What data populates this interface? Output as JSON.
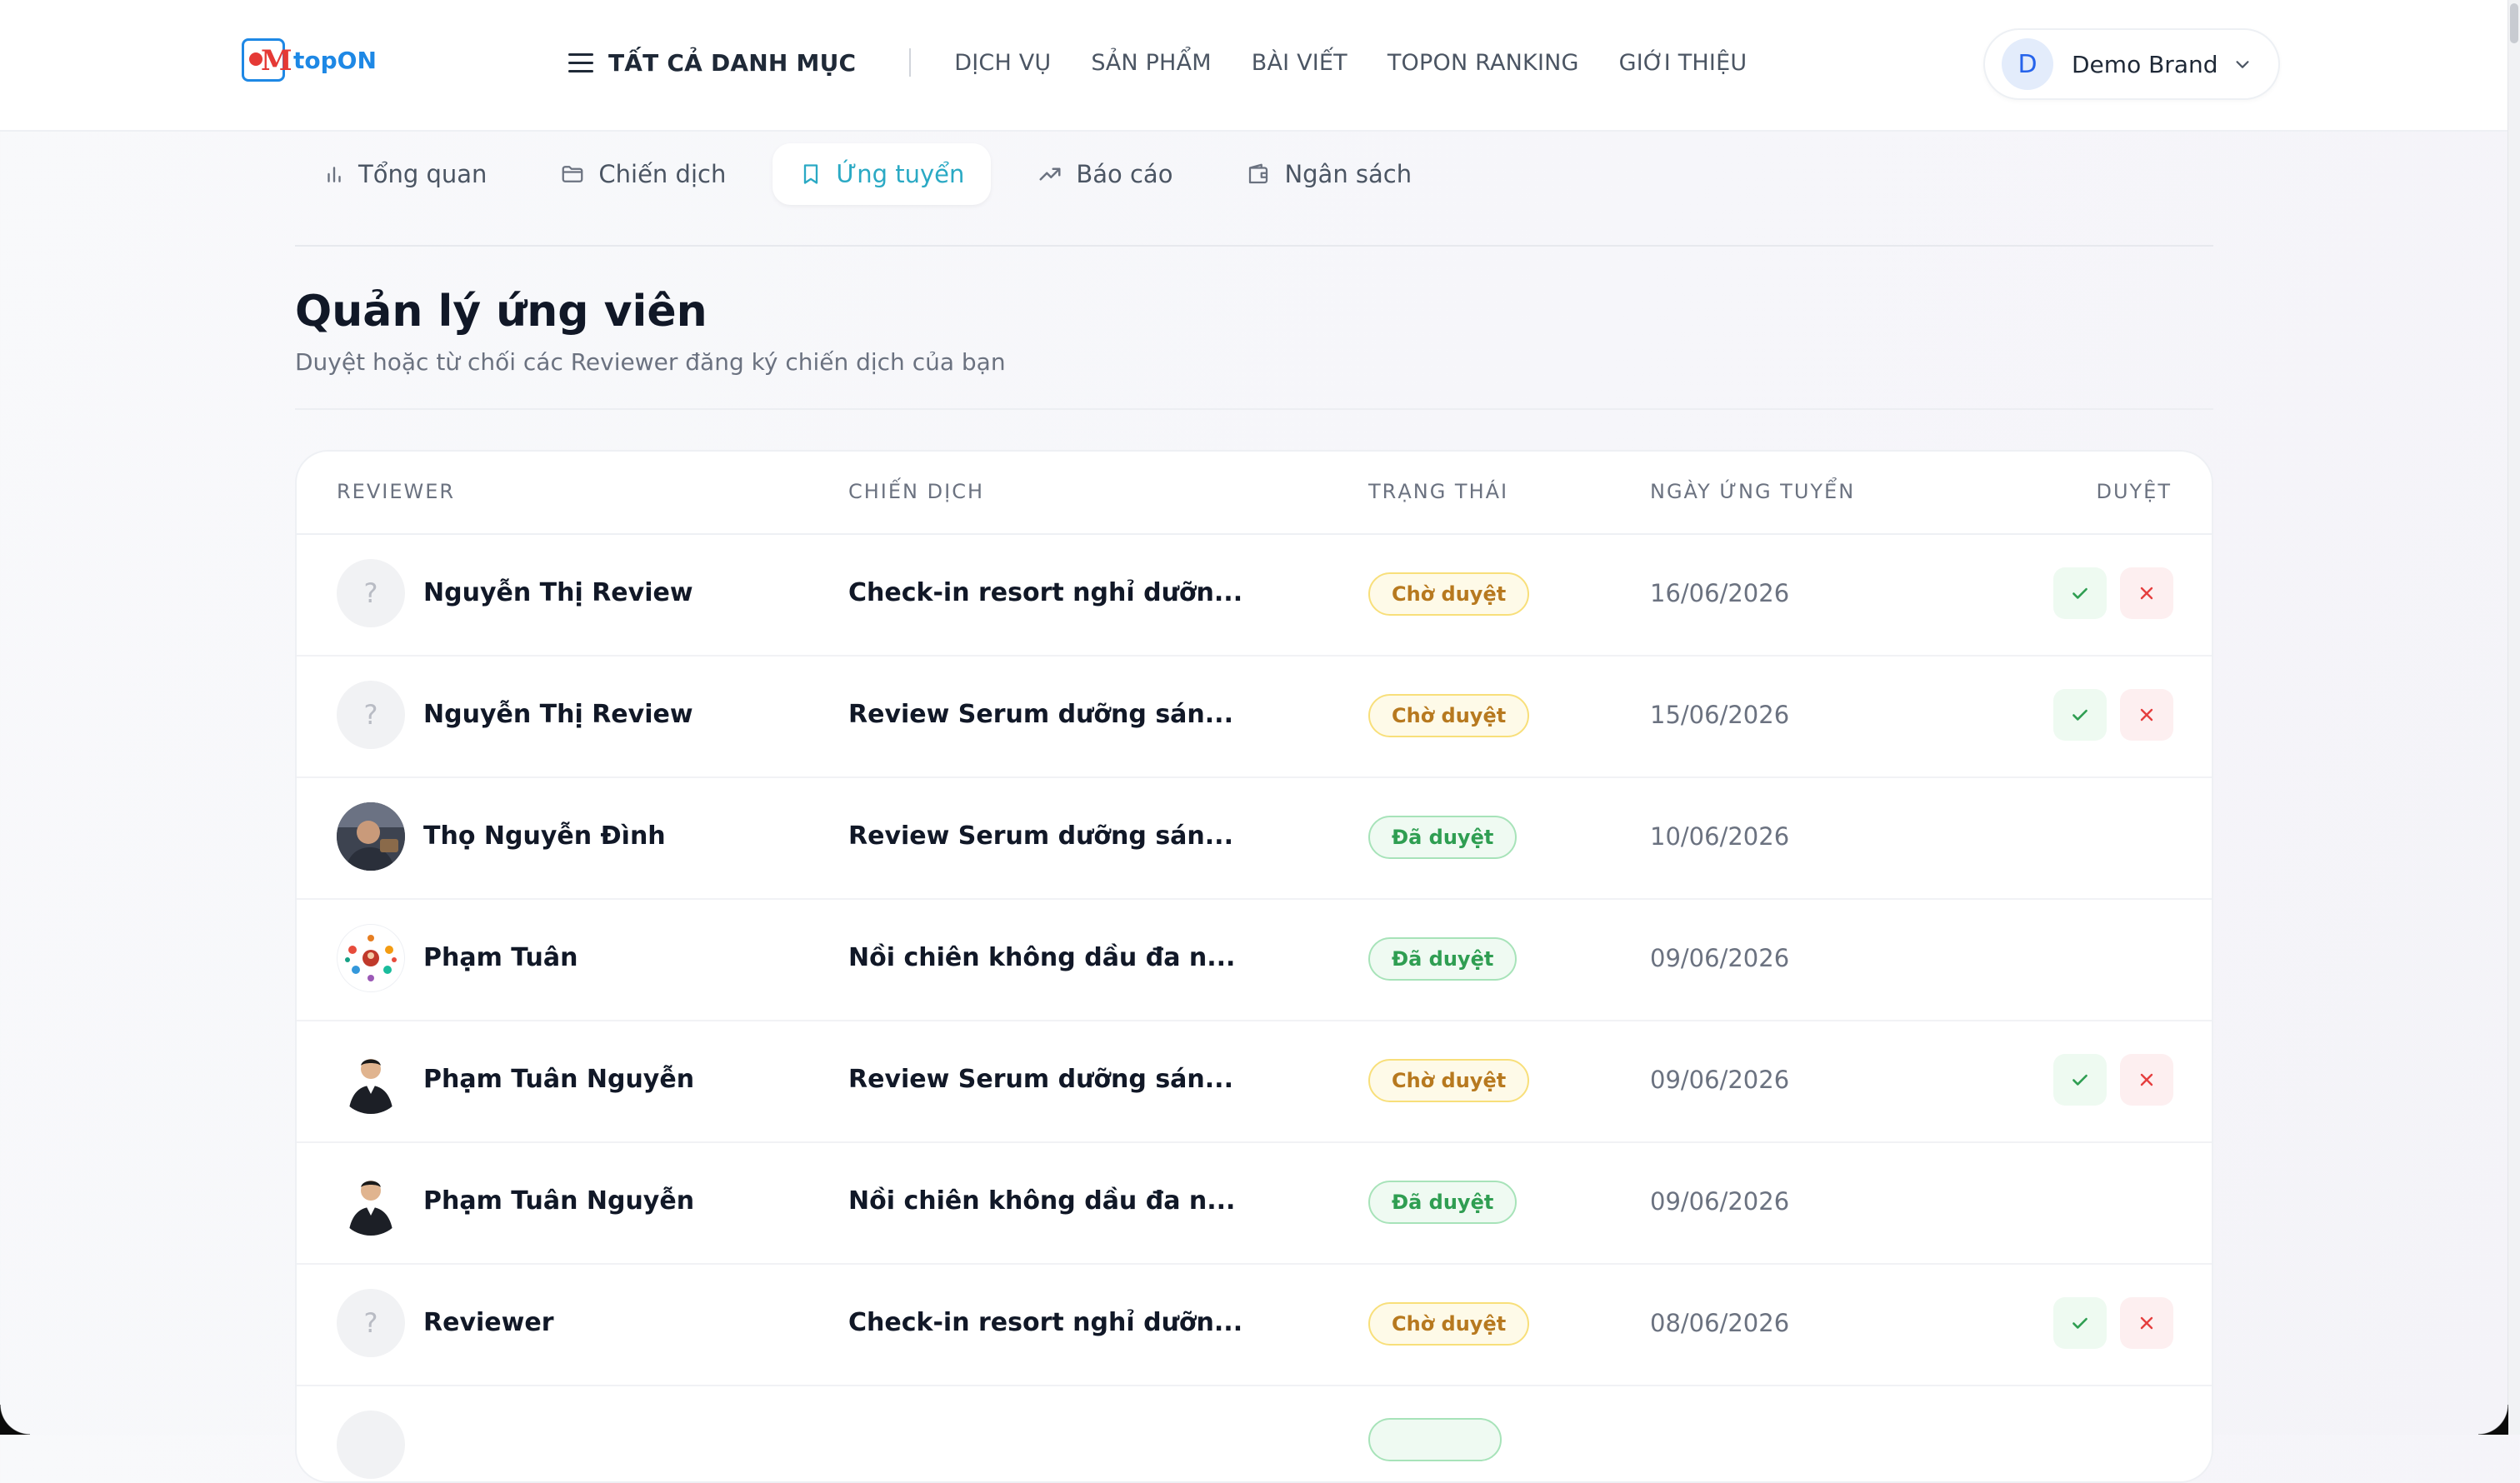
{
  "header": {
    "logo_text": "topON",
    "menu_all": "TẤT CẢ DANH MỤC",
    "nav": [
      "DỊCH VỤ",
      "SẢN PHẨM",
      "BÀI VIẾT",
      "TOPON RANKING",
      "GIỚI THIỆU"
    ],
    "user": {
      "initial": "D",
      "name": "Demo Brand"
    }
  },
  "tabs": [
    {
      "label": "Tổng quan",
      "icon": "bar-chart-icon"
    },
    {
      "label": "Chiến dịch",
      "icon": "folder-icon"
    },
    {
      "label": "Ứng tuyển",
      "icon": "bookmark-icon",
      "active": true
    },
    {
      "label": "Báo cáo",
      "icon": "trending-up-icon"
    },
    {
      "label": "Ngân sách",
      "icon": "wallet-icon"
    }
  ],
  "page": {
    "title": "Quản lý ứng viên",
    "subtitle": "Duyệt hoặc từ chối các Reviewer đăng ký chiến dịch của bạn"
  },
  "table": {
    "columns": [
      "REVIEWER",
      "CHIẾN DỊCH",
      "TRẠNG THÁI",
      "NGÀY ỨNG TUYỂN",
      "DUYỆT"
    ],
    "rows": [
      {
        "reviewer": "Nguyễn Thị Review",
        "avatar": "?",
        "campaign": "Check-in resort nghỉ dưỡn...",
        "status": "Chờ duyệt",
        "date": "16/06/2026"
      },
      {
        "reviewer": "Nguyễn Thị Review",
        "avatar": "?",
        "campaign": "Review Serum dưỡng sán...",
        "status": "Chờ duyệt",
        "date": "15/06/2026"
      },
      {
        "reviewer": "Thọ Nguyễn Đình",
        "avatar": "",
        "campaign": "Review Serum dưỡng sán...",
        "status": "Đã duyệt",
        "date": "10/06/2026"
      },
      {
        "reviewer": "Phạm Tuân",
        "avatar": "",
        "campaign": "Nồi chiên không dầu đa n...",
        "status": "Đã duyệt",
        "date": "09/06/2026"
      },
      {
        "reviewer": "Phạm Tuân Nguyễn",
        "avatar": "",
        "campaign": "Review Serum dưỡng sán...",
        "status": "Chờ duyệt",
        "date": "09/06/2026"
      },
      {
        "reviewer": "Phạm Tuân Nguyễn",
        "avatar": "",
        "campaign": "Nồi chiên không dầu đa n...",
        "status": "Đã duyệt",
        "date": "09/06/2026"
      },
      {
        "reviewer": "Reviewer",
        "avatar": "?",
        "campaign": "Check-in resort nghỉ dưỡn...",
        "status": "Chờ duyệt",
        "date": "08/06/2026"
      }
    ]
  },
  "colors": {
    "accent": "#2aa9c4",
    "pending": "#b7791f",
    "approved": "#2f9e52",
    "reject": "#e53e3e",
    "brand_blue": "#1e88e5",
    "brand_red": "#e53935"
  }
}
